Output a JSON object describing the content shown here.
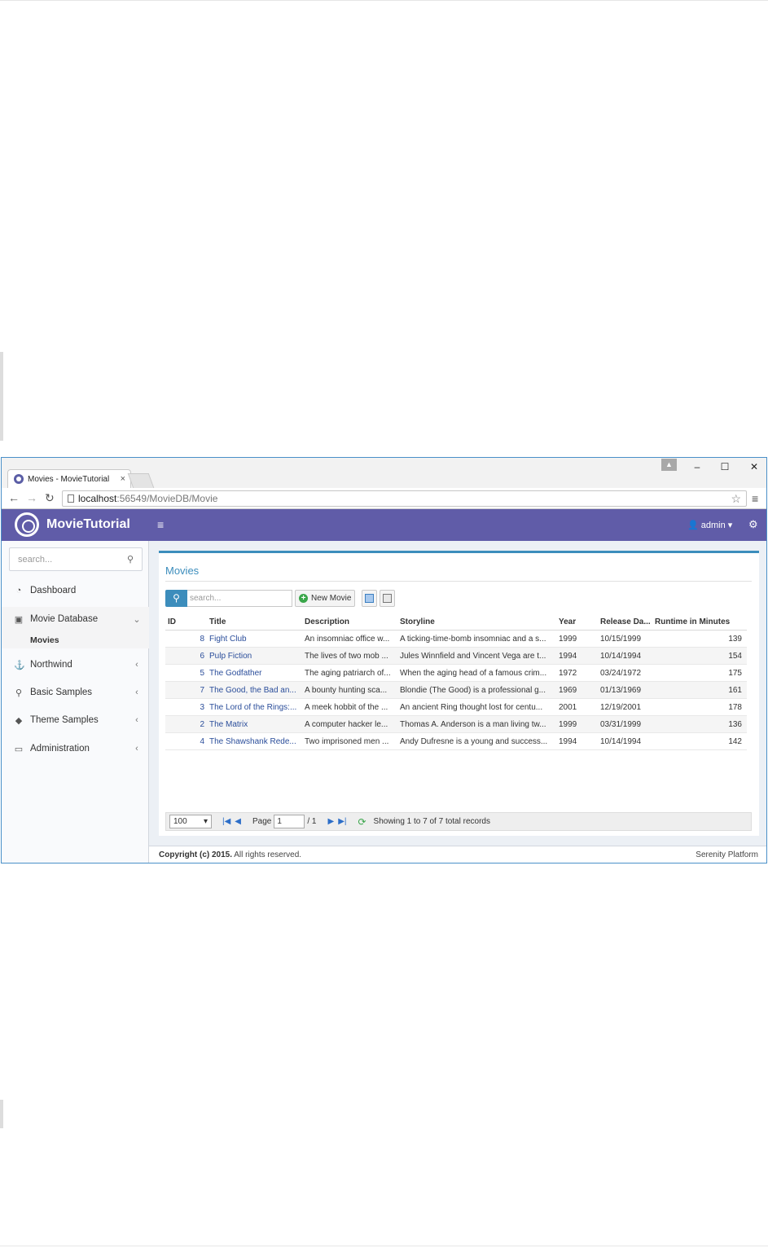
{
  "browser": {
    "tab_title": "Movies - MovieTutorial",
    "tab_close": "×",
    "url_host": "localhost",
    "url_rest": ":56549/MovieDB/Movie",
    "minimize": "–",
    "maximize": "☐",
    "close": "✕"
  },
  "header": {
    "brand": "MovieTutorial",
    "user": "admin"
  },
  "sidebar": {
    "search_placeholder": "search...",
    "items": [
      {
        "label": "Dashboard",
        "icon": "dashboard-icon"
      },
      {
        "label": "Movie Database",
        "icon": "film-icon"
      },
      {
        "label": "Northwind",
        "icon": "anchor-icon"
      },
      {
        "label": "Basic Samples",
        "icon": "magic-icon"
      },
      {
        "label": "Theme Samples",
        "icon": "diamond-icon"
      },
      {
        "label": "Administration",
        "icon": "desktop-icon"
      }
    ],
    "sub_item": "Movies"
  },
  "main": {
    "title": "Movies",
    "search_placeholder": "search...",
    "new_button": "New Movie",
    "columns": [
      "ID",
      "Title",
      "Description",
      "Storyline",
      "Year",
      "Release Da...",
      "Runtime in Minutes"
    ],
    "rows": [
      [
        "8",
        "Fight Club",
        "An insomniac office w...",
        "A ticking-time-bomb insomniac and a s...",
        "1999",
        "10/15/1999",
        "139"
      ],
      [
        "6",
        "Pulp Fiction",
        "The lives of two mob ...",
        "Jules Winnfield and Vincent Vega are t...",
        "1994",
        "10/14/1994",
        "154"
      ],
      [
        "5",
        "The Godfather",
        "The aging patriarch of...",
        "When the aging head of a famous crim...",
        "1972",
        "03/24/1972",
        "175"
      ],
      [
        "7",
        "The Good, the Bad an...",
        "A bounty hunting sca...",
        "Blondie (The Good) is a professional g...",
        "1969",
        "01/13/1969",
        "161"
      ],
      [
        "3",
        "The Lord of the Rings:...",
        "A meek hobbit of the ...",
        "An ancient Ring thought lost for centu...",
        "2001",
        "12/19/2001",
        "178"
      ],
      [
        "2",
        "The Matrix",
        "A computer hacker le...",
        "Thomas A. Anderson is a man living tw...",
        "1999",
        "03/31/1999",
        "136"
      ],
      [
        "4",
        "The Shawshank Rede...",
        "Two imprisoned men ...",
        "Andy Dufresne is a young and success...",
        "1994",
        "10/14/1994",
        "142"
      ]
    ],
    "pager": {
      "page_size": "100",
      "page_label": "Page",
      "page_value": "1",
      "page_total": "/ 1",
      "status": "Showing 1 to 7 of 7 total records"
    }
  },
  "footer": {
    "copyright": "Copyright (c) 2015.",
    "rights": " All rights reserved.",
    "platform": "Serenity Platform"
  },
  "colors": {
    "header": "#605ca8",
    "accent": "#3c8dbc",
    "link": "#2a4d9a"
  }
}
